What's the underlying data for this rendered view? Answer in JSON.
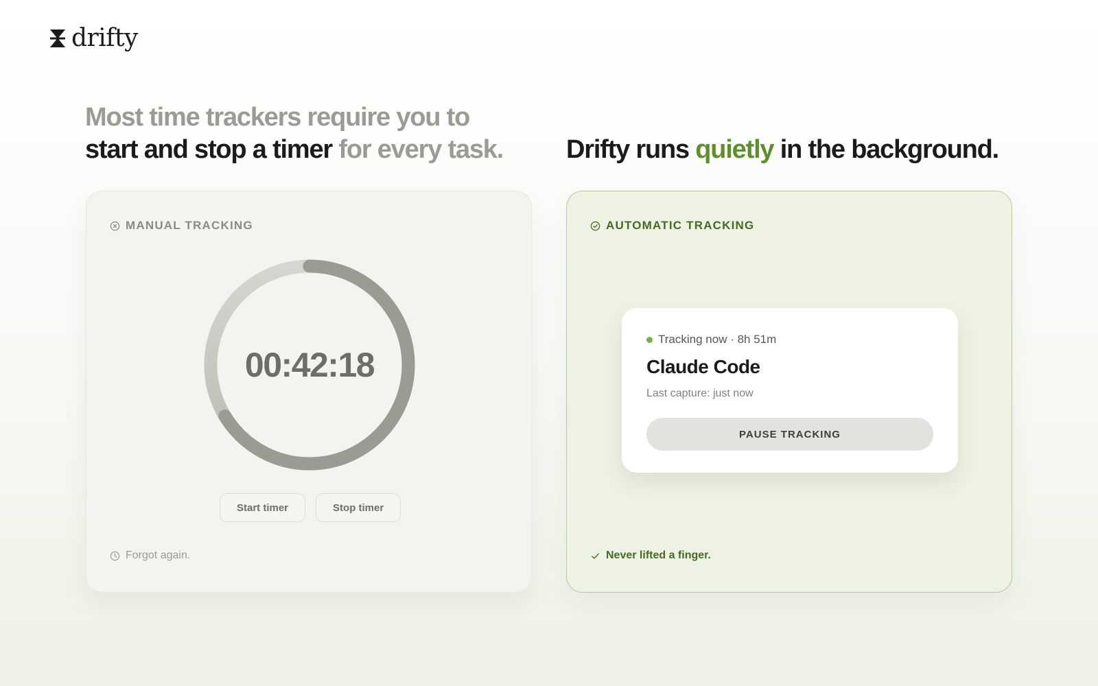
{
  "brand": {
    "name": "drifty",
    "logo_icon": "hourglass-icon"
  },
  "left": {
    "headline_line1": "Most time trackers require you to",
    "headline_line2_dark": "start and stop a timer",
    "headline_line2_muted": "for every task.",
    "card": {
      "label": "MANUAL TRACKING",
      "label_icon": "x-circle-icon",
      "timer": "00:42:18",
      "start_button": "Start timer",
      "stop_button": "Stop timer",
      "footer": "Forgot again.",
      "footer_icon": "clock-icon"
    }
  },
  "right": {
    "headline_before": "Drifty runs",
    "headline_accent": "quietly",
    "headline_after": "in the background.",
    "card": {
      "label": "AUTOMATIC TRACKING",
      "label_icon": "check-circle-icon",
      "status": {
        "tracking_text": "Tracking now · 8h 51m",
        "title": "Claude Code",
        "subtitle": "Last capture: just now",
        "pause_button": "PAUSE TRACKING"
      },
      "footer": "Never lifted a finger.",
      "footer_icon": "check-icon"
    }
  },
  "colors": {
    "accent_green": "#5e8e2e",
    "label_green": "#456a22",
    "status_dot": "#7cae48",
    "muted_text": "#9a9b94",
    "ring_gray": "#9a9b93"
  }
}
